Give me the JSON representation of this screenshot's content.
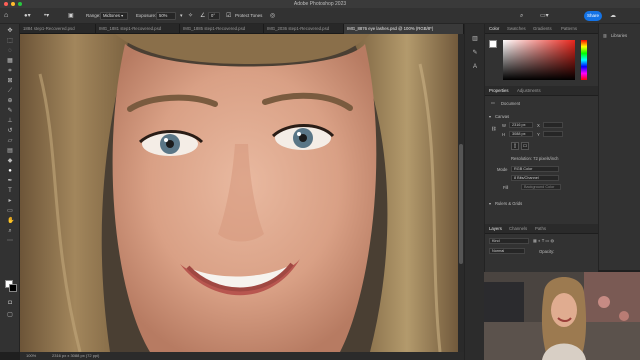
{
  "window": {
    "title": "Adobe Photoshop 2023"
  },
  "options_bar": {
    "range_label": "Range:",
    "range_value": "Midtones",
    "exposure_label": "Exposure:",
    "exposure_value": "50%",
    "angle_value": "0°",
    "protect_tones_label": "Protect Tones",
    "share_label": "Share"
  },
  "document_tabs": [
    {
      "label": "1884 step1-Recovered.psd"
    },
    {
      "label": "IMG_1881 step1-Recovered.psd"
    },
    {
      "label": "IMG_1885 step1-Recovered.psd"
    },
    {
      "label": "IMG_2036 step1-Recovered.psd"
    },
    {
      "label": "IMG_8876 eye lashes.psd @ 100% (RGB/8*)",
      "active": true
    }
  ],
  "color_panel": {
    "tabs": [
      "Color",
      "Swatches",
      "Gradients",
      "Patterns"
    ]
  },
  "libraries_label": "Libraries",
  "properties_panel": {
    "tabs": [
      "Properties",
      "Adjustments"
    ],
    "doc_label": "Document",
    "canvas_label": "Canvas",
    "w_label": "W",
    "w_value": "2316 px",
    "h_label": "H",
    "h_value": "3088 px",
    "x_label": "X",
    "y_label": "Y",
    "resolution_text": "Resolution: 72 pixels/inch",
    "mode_label": "Mode",
    "mode_value": "RGB Color",
    "bit_value": "8 Bits/Channel",
    "fill_label": "Fill",
    "fill_value": "Background Color",
    "rulers_label": "Rulers & Grids"
  },
  "layers_panel": {
    "tabs": [
      "Layers",
      "Channels",
      "Paths"
    ],
    "kind_placeholder": "Kind",
    "normal_label": "Normal",
    "opacity_label": "Opacity:"
  },
  "status_bar": {
    "zoom": "100%",
    "doc_size": "2316 px x 3088 px (72 ppi)"
  },
  "colors": {
    "accent": "#1473e6",
    "background": "#1f1f1f"
  }
}
